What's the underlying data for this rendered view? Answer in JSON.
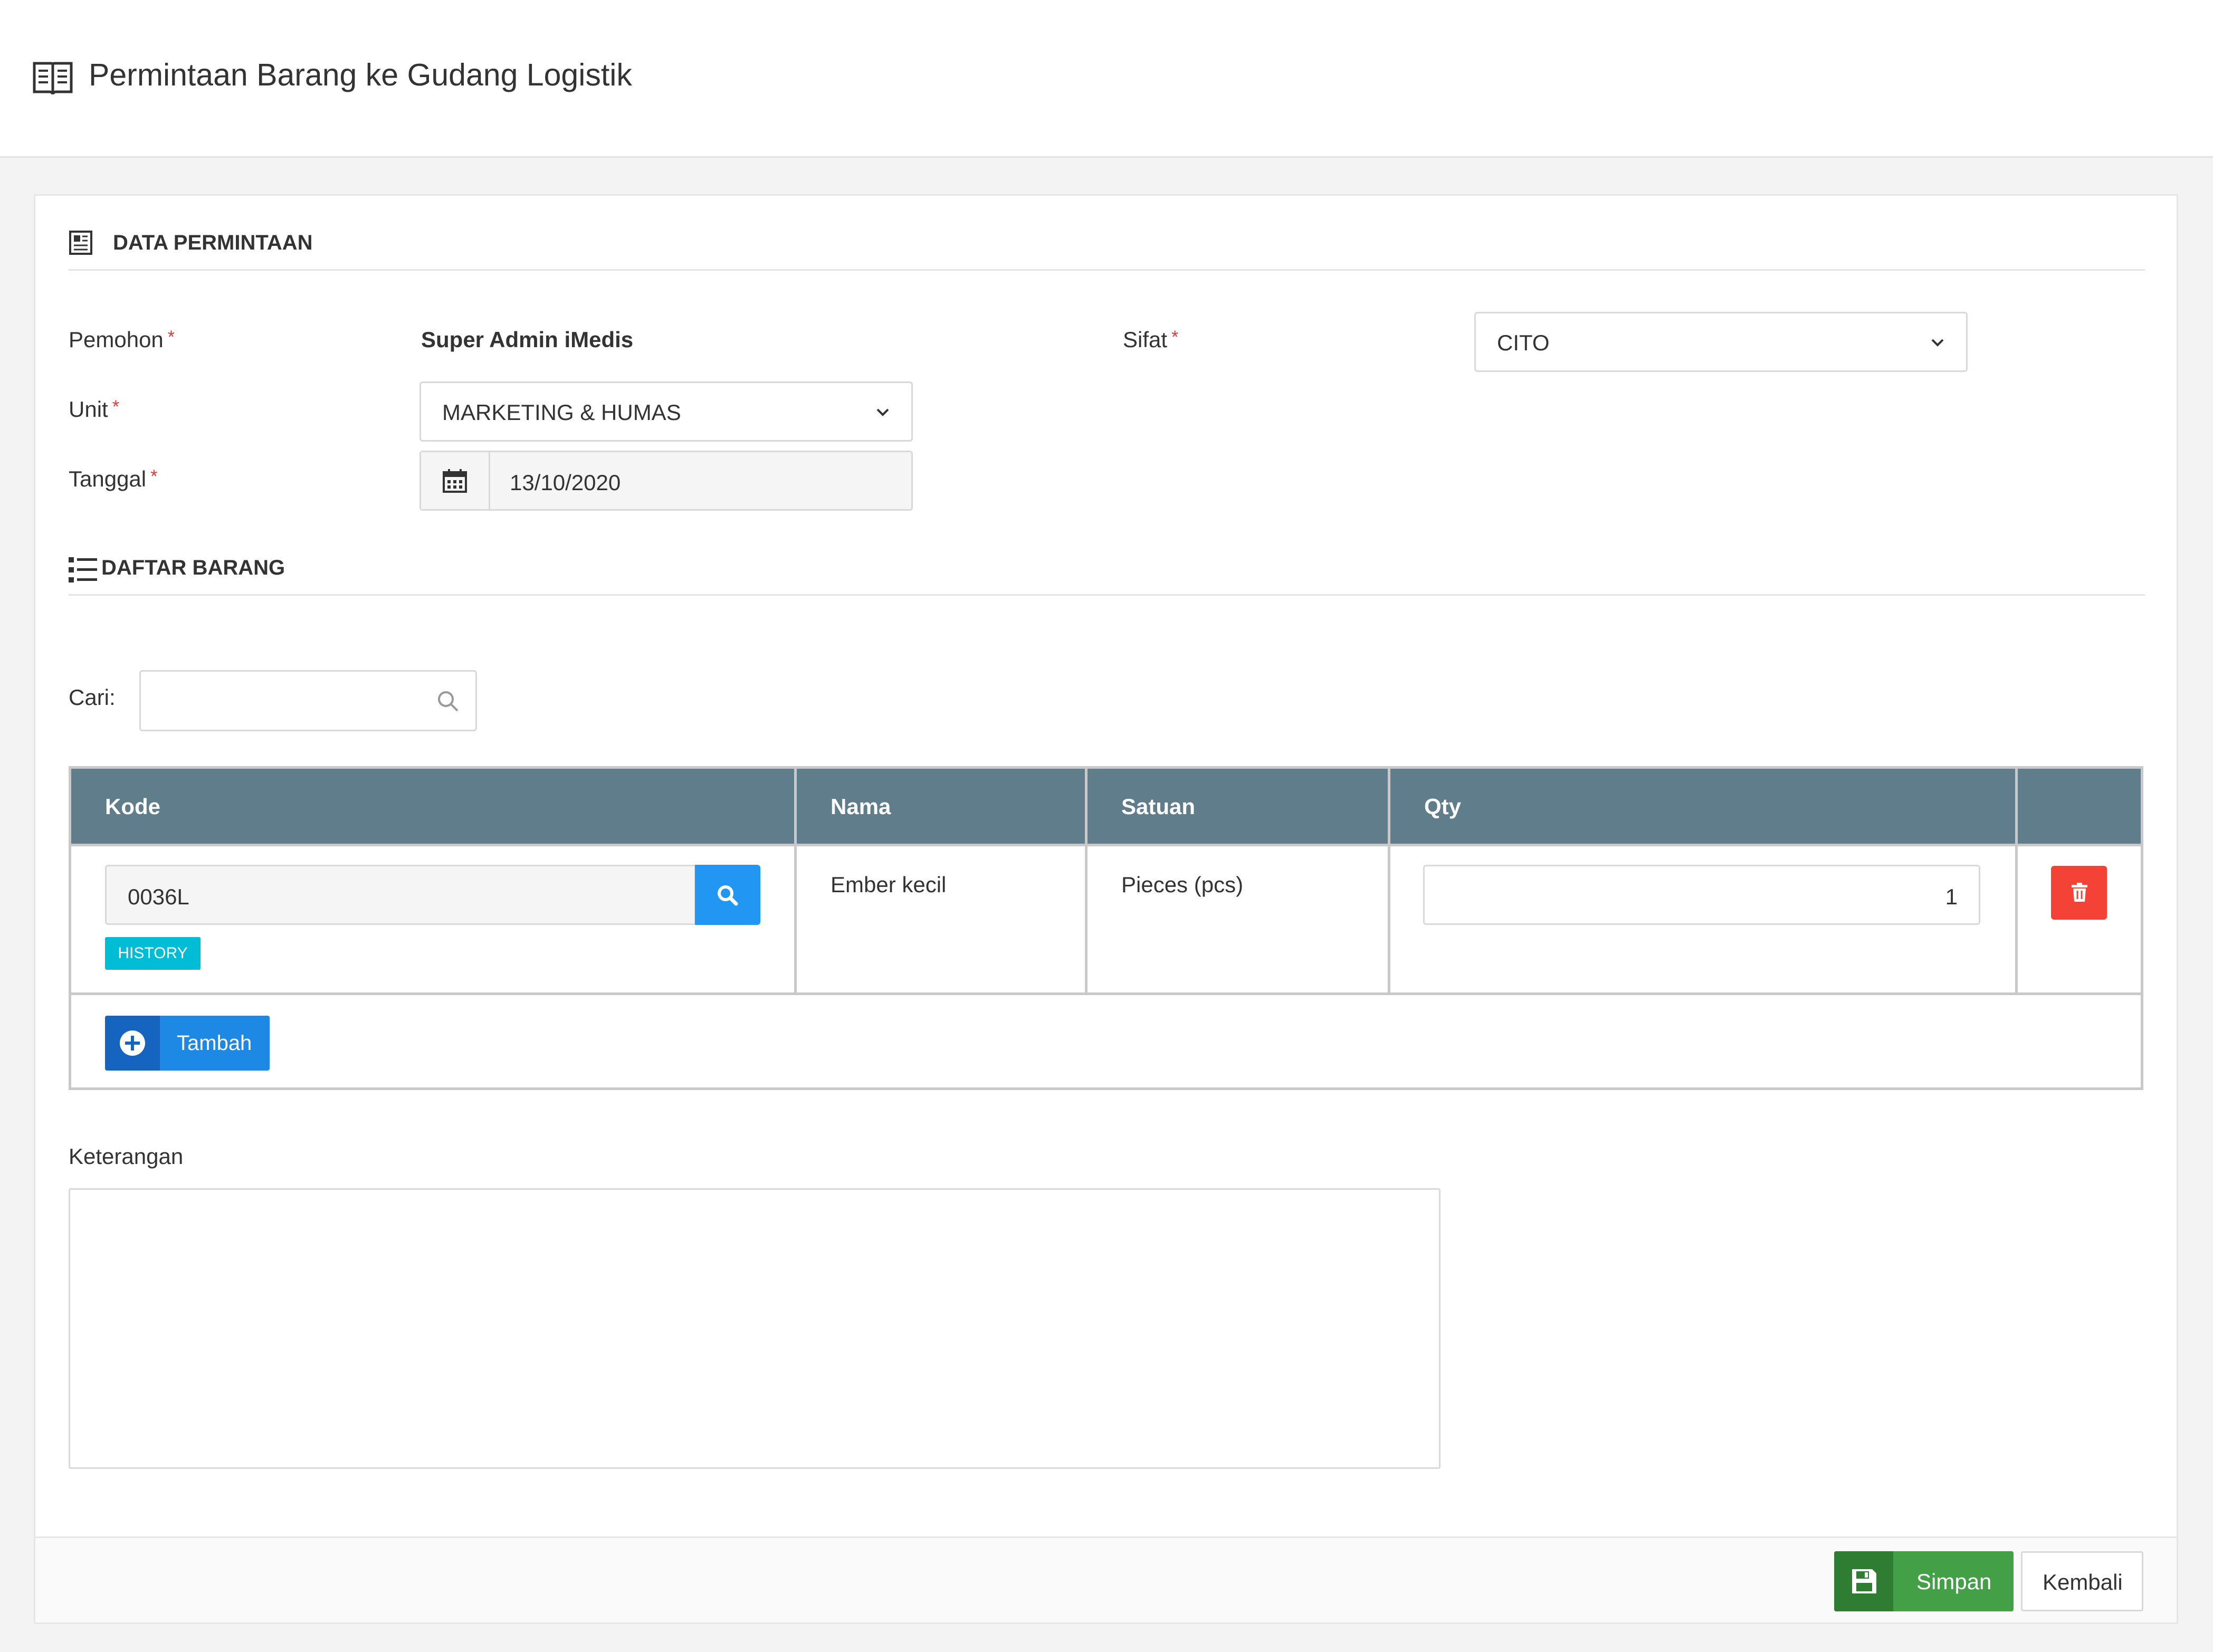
{
  "page": {
    "title": "Permintaan Barang ke Gudang Logistik",
    "title_icon": "open-book-icon"
  },
  "data_permintaan": {
    "heading": "DATA PERMINTAAN",
    "heading_icon": "newspaper-icon",
    "required_mark": "*",
    "pemohon_label": "Pemohon",
    "pemohon_value": "Super Admin iMedis",
    "unit_label": "Unit",
    "unit_value": "MARKETING & HUMAS",
    "tanggal_label": "Tanggal",
    "tanggal_value": "13/10/2020",
    "sifat_label": "Sifat",
    "sifat_value": "CITO"
  },
  "daftar_barang": {
    "heading": "DAFTAR BARANG",
    "heading_icon": "list-icon",
    "search_label": "Cari:",
    "search_value": "",
    "columns": [
      "Kode",
      "Nama",
      "Satuan",
      "Qty",
      ""
    ],
    "rows": [
      {
        "kode": "0036L",
        "history_label": "HISTORY",
        "nama": "Ember kecil",
        "satuan": "Pieces (pcs)",
        "qty": "1"
      }
    ],
    "add_label": "Tambah"
  },
  "keterangan": {
    "label": "Keterangan",
    "value": ""
  },
  "footer": {
    "save_label": "Simpan",
    "back_label": "Kembali"
  },
  "colors": {
    "table_header": "#607d8b",
    "primary": "#2196f3",
    "danger": "#f44336",
    "success": "#43a047",
    "info": "#00bcd4"
  }
}
